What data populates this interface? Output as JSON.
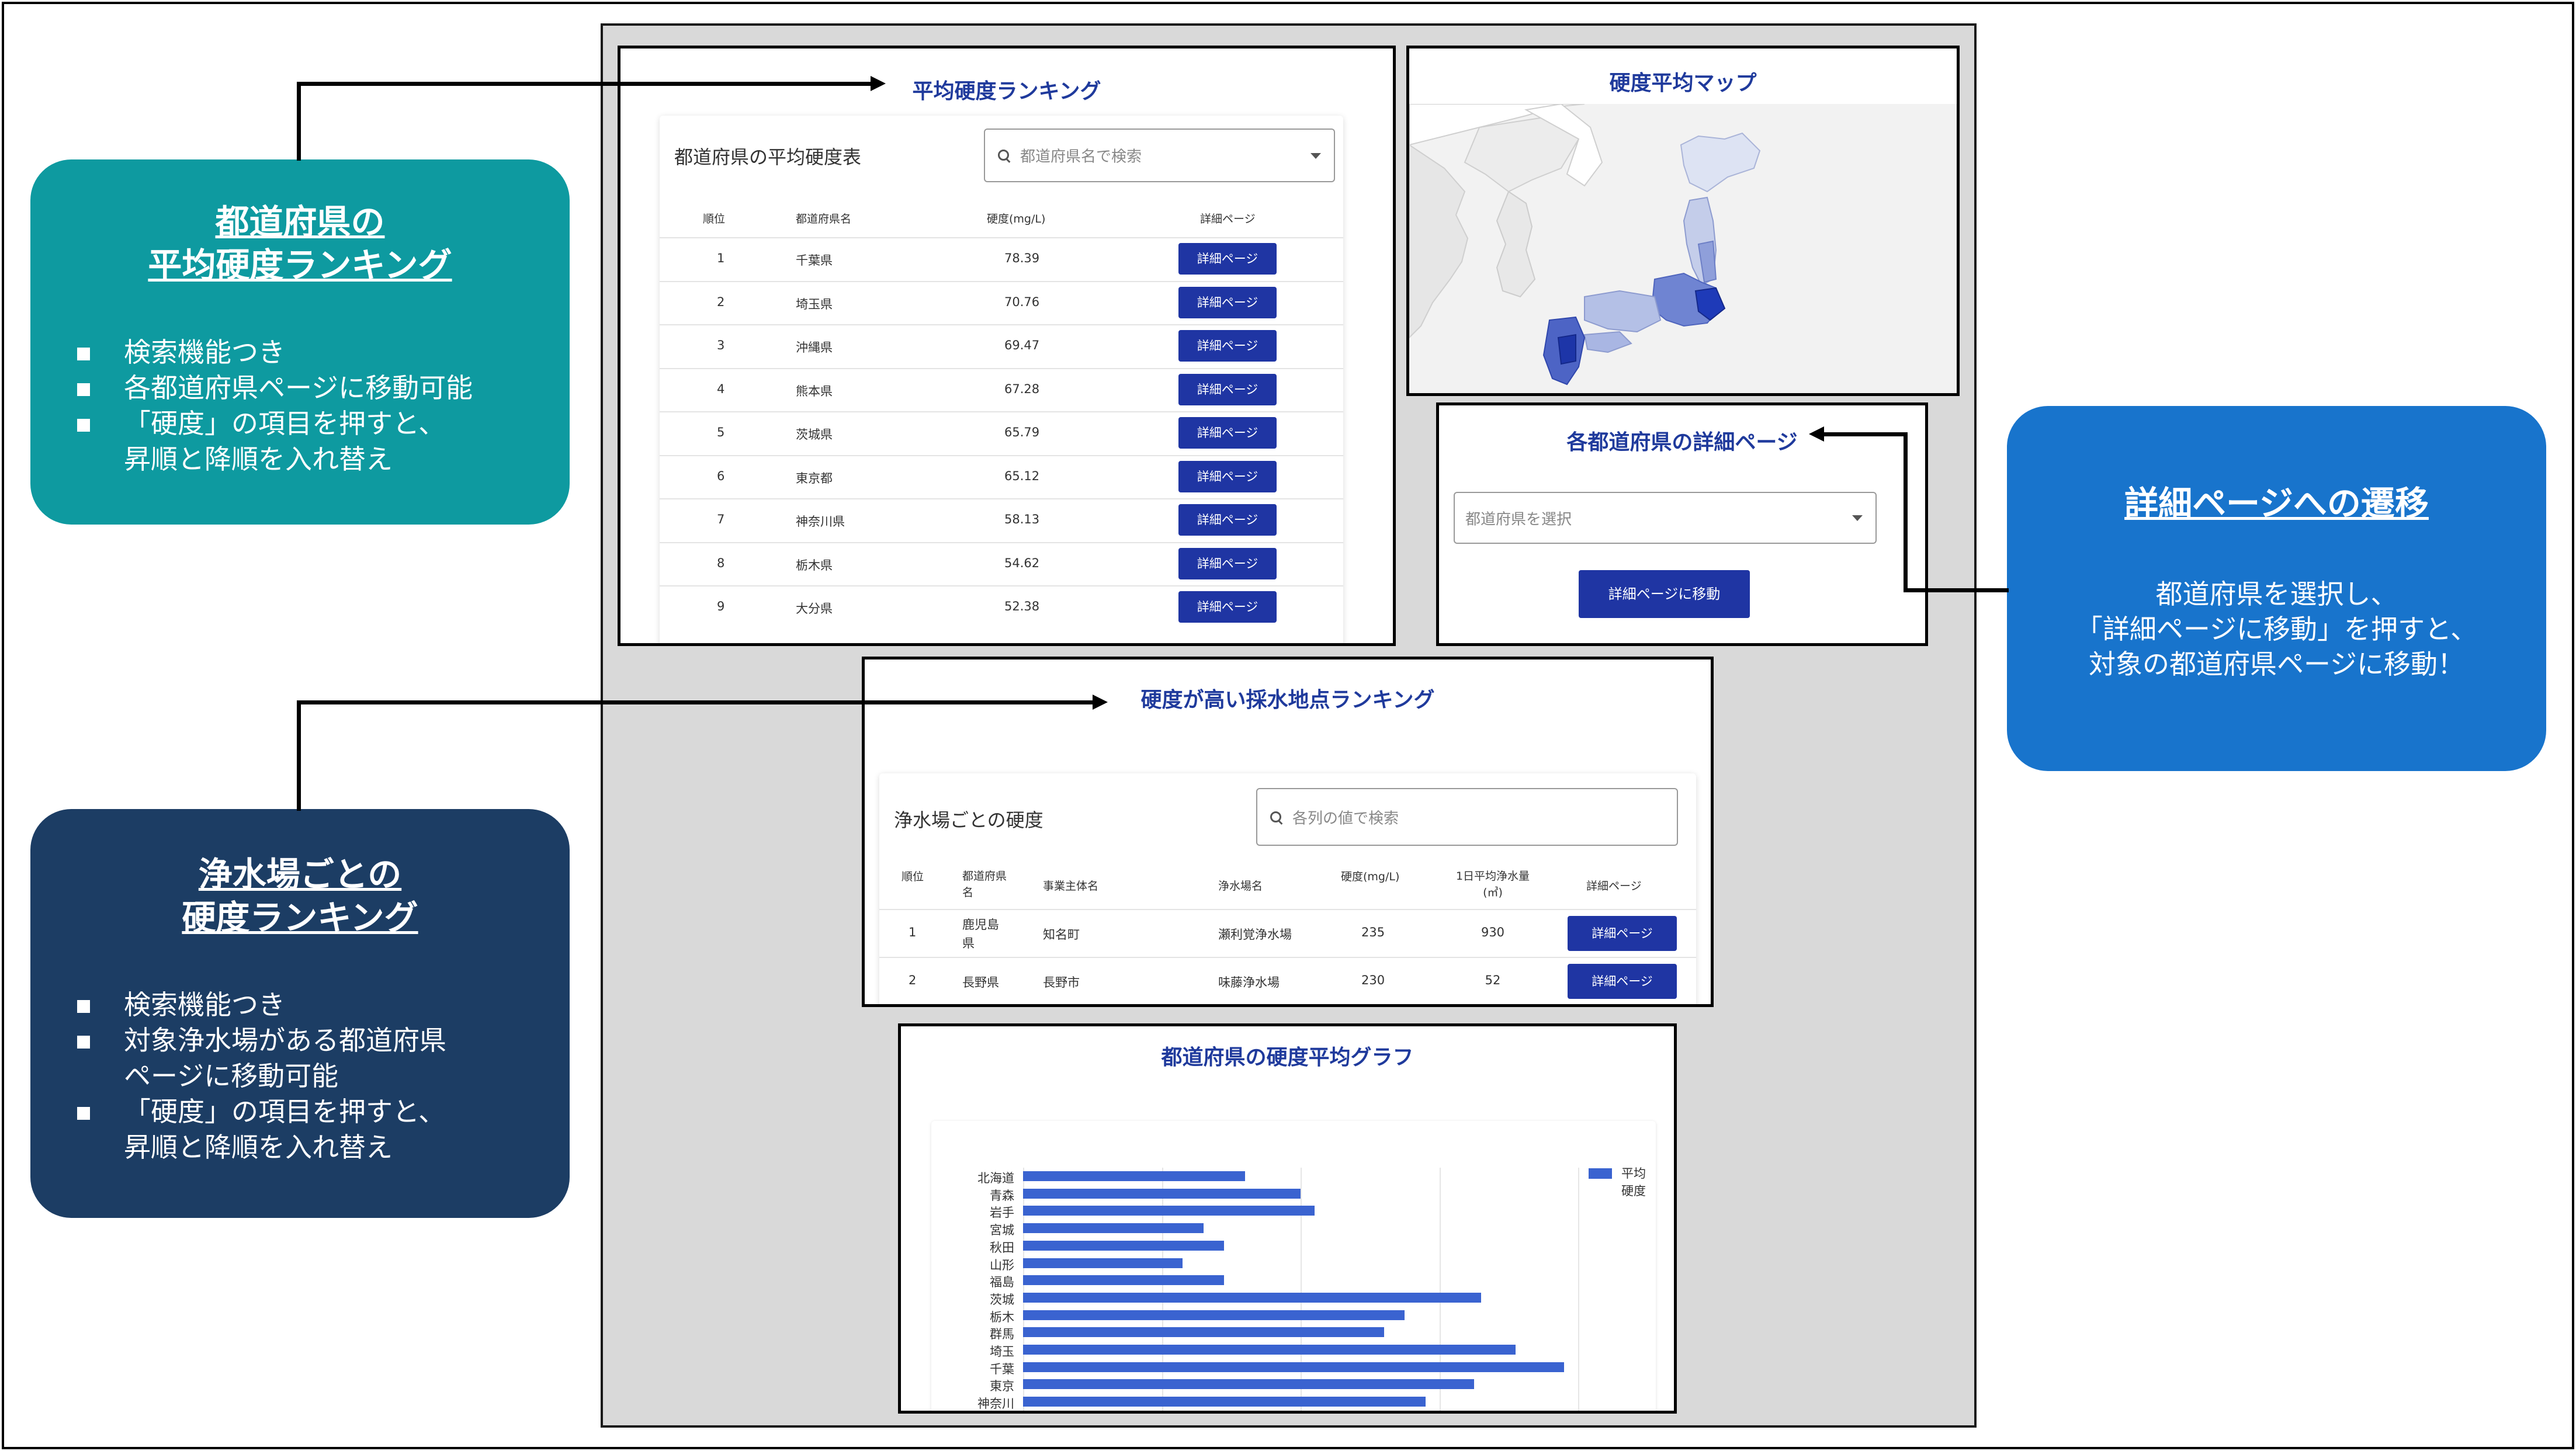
{
  "callouts": {
    "prefecture_ranking": {
      "title_line1": "都道府県の",
      "title_line2": "平均硬度ランキング",
      "bullets": [
        "検索機能つき",
        "各都道府県ページに移動可能",
        "「硬度」の項目を押すと、",
        "昇順と降順を入れ替え"
      ]
    },
    "plant_ranking": {
      "title_line1": "浄水場ごとの",
      "title_line2": "硬度ランキング",
      "bullets": [
        "検索機能つき",
        "対象浄水場がある都道府県",
        "ページに移動可能",
        "「硬度」の項目を押すと、",
        "昇順と降順を入れ替え"
      ]
    },
    "detail_transition": {
      "title": "詳細ページへの遷移",
      "body_line1": "都道府県を選択し、",
      "body_line2": "「詳細ページに移動」を押すと、",
      "body_line3": "対象の都道府県ページに移動！"
    }
  },
  "ranking_panel": {
    "title": "平均硬度ランキング",
    "table_heading": "都道府県の平均硬度表",
    "search_placeholder": "都道府県名で検索",
    "columns": [
      "順位",
      "都道府県名",
      "硬度(mg/L)",
      "詳細ページ"
    ],
    "button_label": "詳細ページ",
    "rows": [
      {
        "rank": "1",
        "pref": "千葉県",
        "value": "78.39"
      },
      {
        "rank": "2",
        "pref": "埼玉県",
        "value": "70.76"
      },
      {
        "rank": "3",
        "pref": "沖縄県",
        "value": "69.47"
      },
      {
        "rank": "4",
        "pref": "熊本県",
        "value": "67.28"
      },
      {
        "rank": "5",
        "pref": "茨城県",
        "value": "65.79"
      },
      {
        "rank": "6",
        "pref": "東京都",
        "value": "65.12"
      },
      {
        "rank": "7",
        "pref": "神奈川県",
        "value": "58.13"
      },
      {
        "rank": "8",
        "pref": "栃木県",
        "value": "54.62"
      },
      {
        "rank": "9",
        "pref": "大分県",
        "value": "52.38"
      }
    ]
  },
  "map_panel": {
    "title": "硬度平均マップ"
  },
  "detail_panel": {
    "title": "各都道府県の詳細ページ",
    "select_placeholder": "都道府県を選択",
    "button_label": "詳細ページに移動"
  },
  "plant_panel": {
    "title": "硬度が高い採水地点ランキング",
    "table_heading": "浄水場ごとの硬度",
    "search_placeholder": "各列の値で検索",
    "columns": {
      "rank": "順位",
      "pref_line1": "都道府県",
      "pref_line2": "名",
      "operator": "事業主体名",
      "plant": "浄水場名",
      "hardness": "硬度(mg/L)",
      "volume_line1": "1日平均浄水量",
      "volume_line2": "(㎥)",
      "detail": "詳細ページ"
    },
    "button_label": "詳細ページ",
    "rows": [
      {
        "rank": "1",
        "pref_line1": "鹿児島",
        "pref_line2": "県",
        "operator": "知名町",
        "plant": "瀬利覚浄水場",
        "hardness": "235",
        "volume": "930"
      },
      {
        "rank": "2",
        "pref_line1": "長野県",
        "pref_line2": "",
        "operator": "長野市",
        "plant": "味藤浄水場",
        "hardness": "230",
        "volume": "52"
      }
    ]
  },
  "graph_panel": {
    "title": "都道府県の硬度平均グラフ",
    "legend_line1": "平均",
    "legend_line2": "硬度"
  },
  "chart_data": {
    "type": "bar",
    "orientation": "horizontal",
    "title": "都道府県の硬度平均グラフ",
    "categories": [
      "北海道",
      "青森",
      "岩手",
      "宮城",
      "秋田",
      "山形",
      "福島",
      "茨城",
      "栃木",
      "群馬",
      "埼玉",
      "千葉",
      "東京",
      "神奈川"
    ],
    "series": [
      {
        "name": "平均硬度",
        "values": [
          32,
          40,
          42,
          26,
          29,
          23,
          29,
          66,
          55,
          52,
          71,
          78,
          65,
          58
        ]
      }
    ],
    "xlim": [
      0,
      80
    ],
    "grid": true,
    "legend_position": "right",
    "colors": {
      "bar": "#3a63d0"
    }
  },
  "colors": {
    "teal_callout": "#0e9aa0",
    "navy_callout": "#1c3d64",
    "blue_callout": "#1874cc",
    "panel_title": "#1f3a9c",
    "button": "#1f35a3"
  }
}
